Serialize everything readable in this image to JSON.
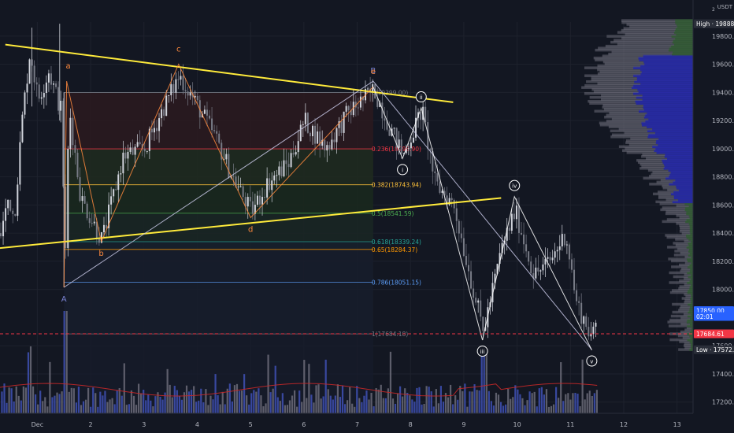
{
  "currency": {
    "top": "USDT",
    "bottom": "2"
  },
  "chart_data": {
    "type": "candlestick",
    "ylim": [
      17120,
      19900
    ],
    "xlim": [
      0.3,
      13.3
    ],
    "x_ticks": [
      {
        "x": 1,
        "label": "Dec"
      },
      {
        "x": 2,
        "label": "2"
      },
      {
        "x": 3,
        "label": "3"
      },
      {
        "x": 4,
        "label": "4"
      },
      {
        "x": 5,
        "label": "5"
      },
      {
        "x": 6,
        "label": "6"
      },
      {
        "x": 7,
        "label": "7"
      },
      {
        "x": 8,
        "label": "8"
      },
      {
        "x": 9,
        "label": "9"
      },
      {
        "x": 10,
        "label": "10"
      },
      {
        "x": 11,
        "label": "11"
      },
      {
        "x": 12,
        "label": "12"
      },
      {
        "x": 13,
        "label": "13"
      }
    ],
    "y_ticks": [
      {
        "v": 19800,
        "label": "19800.00"
      },
      {
        "v": 19600,
        "label": "19600.00"
      },
      {
        "v": 19400,
        "label": "19400.00"
      },
      {
        "v": 19200,
        "label": "19200.00"
      },
      {
        "v": 19000,
        "label": "19000.00"
      },
      {
        "v": 18800,
        "label": "18800.00"
      },
      {
        "v": 18600,
        "label": "18600.00"
      },
      {
        "v": 18400,
        "label": "18400.00"
      },
      {
        "v": 18200,
        "label": "18200.00"
      },
      {
        "v": 18000,
        "label": "18000.00"
      },
      {
        "v": 17600,
        "label": "17600.00"
      },
      {
        "v": 17400,
        "label": "17400.00"
      },
      {
        "v": 17200,
        "label": "17200.00"
      }
    ],
    "price_tags": [
      {
        "v": 19888.0,
        "label": "High · 19888.00",
        "color": "#2a2e39"
      },
      {
        "v": 17850.0,
        "label": "17850.00",
        "color": "#2962ff"
      },
      {
        "v": 17808.0,
        "label": "02:01",
        "color": "#2962ff"
      },
      {
        "v": 17684.61,
        "label": "17684.61",
        "color": "#f23645"
      },
      {
        "v": 17572.33,
        "label": "Low · 17572.33",
        "color": "#2a2e39"
      }
    ],
    "current_price": 17684.61,
    "fib_levels": [
      {
        "ratio": "0",
        "value": 19399.0,
        "label": "0(19399.00)",
        "color": "#787b86",
        "fill": "#2a1a1f"
      },
      {
        "ratio": "0.236",
        "value": 18999.0,
        "label": "0.236(18998.90)",
        "color": "#f23645",
        "fill": "#2a1a1f"
      },
      {
        "ratio": "0.382",
        "value": 18743.94,
        "label": "0.382(18743.94)",
        "color": "#ffc23a",
        "fill": "#1f2a1f"
      },
      {
        "ratio": "0.5",
        "value": 18541.59,
        "label": "0.5(18541.59)",
        "color": "#4caf50",
        "fill": "#1a281e"
      },
      {
        "ratio": "0.618",
        "value": 18339.24,
        "label": "0.618(18339.24)",
        "color": "#26a69a",
        "fill": "#1a2623"
      },
      {
        "ratio": "0.65",
        "value": 18284.37,
        "label": "0.65(18284.37)",
        "color": "#ff9800",
        "fill": "#17202b"
      },
      {
        "ratio": "0.786",
        "value": 18051.15,
        "label": "0.786(18051.15)",
        "color": "#5b9cf6",
        "fill": "#171d2b"
      },
      {
        "ratio": "1",
        "value": 17684.18,
        "label": "1(17684.18)",
        "color": "#787b86",
        "fill": "#171d2b"
      }
    ],
    "triangle_lines": [
      {
        "x1": 0.4,
        "y1": 19740,
        "x2": 8.8,
        "y2": 19330
      },
      {
        "x1": 0.2,
        "y1": 18290,
        "x2": 9.7,
        "y2": 18650
      }
    ],
    "wave_abcde": {
      "points": [
        {
          "x": 1.5,
          "y": 18015,
          "label": ""
        },
        {
          "x": 1.55,
          "y": 19480,
          "label": "a"
        },
        {
          "x": 2.2,
          "y": 18340,
          "label": "b"
        },
        {
          "x": 3.65,
          "y": 19600,
          "label": "c"
        },
        {
          "x": 5.0,
          "y": 18510,
          "label": "d"
        },
        {
          "x": 7.3,
          "y": 19440,
          "label": "e"
        }
      ],
      "color": "#ff8a3d"
    },
    "wave_ABC": {
      "points": [
        {
          "x": 1.5,
          "y": 18015,
          "label": "A"
        },
        {
          "x": 7.3,
          "y": 19480,
          "label": "B"
        },
        {
          "x": 11.4,
          "y": 17572,
          "label": "C"
        }
      ],
      "color": "#c8c8e6"
    },
    "wave_impulse": {
      "points": [
        {
          "x": 7.3,
          "y": 19440,
          "label": ""
        },
        {
          "x": 7.85,
          "y": 18930,
          "label": "i"
        },
        {
          "x": 8.2,
          "y": 19290,
          "label": "ii"
        },
        {
          "x": 9.35,
          "y": 17640,
          "label": "iii"
        },
        {
          "x": 9.95,
          "y": 18660,
          "label": "iv"
        },
        {
          "x": 11.4,
          "y": 17570,
          "label": "v"
        }
      ],
      "color": "#ffffff"
    },
    "price_anchors": [
      [
        0.3,
        18400
      ],
      [
        0.45,
        18660
      ],
      [
        0.55,
        18500
      ],
      [
        0.7,
        19200
      ],
      [
        0.85,
        19700
      ],
      [
        1.0,
        19350
      ],
      [
        1.2,
        19550
      ],
      [
        1.45,
        19250
      ],
      [
        1.5,
        18015
      ],
      [
        1.58,
        19300
      ],
      [
        1.8,
        18650
      ],
      [
        2.2,
        18350
      ],
      [
        2.6,
        18950
      ],
      [
        3.0,
        19000
      ],
      [
        3.3,
        19250
      ],
      [
        3.65,
        19520
      ],
      [
        4.0,
        19300
      ],
      [
        4.3,
        19100
      ],
      [
        4.65,
        18800
      ],
      [
        5.0,
        18550
      ],
      [
        5.3,
        18750
      ],
      [
        5.7,
        18900
      ],
      [
        6.0,
        19200
      ],
      [
        6.4,
        19000
      ],
      [
        6.8,
        19250
      ],
      [
        7.3,
        19420
      ],
      [
        7.6,
        19150
      ],
      [
        7.85,
        18950
      ],
      [
        8.2,
        19280
      ],
      [
        8.45,
        18750
      ],
      [
        8.8,
        18600
      ],
      [
        9.1,
        18100
      ],
      [
        9.35,
        17700
      ],
      [
        9.7,
        18300
      ],
      [
        9.95,
        18560
      ],
      [
        10.3,
        18100
      ],
      [
        10.6,
        18200
      ],
      [
        10.9,
        18400
      ],
      [
        11.1,
        17900
      ],
      [
        11.4,
        17650
      ],
      [
        11.5,
        17800
      ]
    ],
    "volume_profile_poc": 19450,
    "volume_ma_label": ""
  }
}
